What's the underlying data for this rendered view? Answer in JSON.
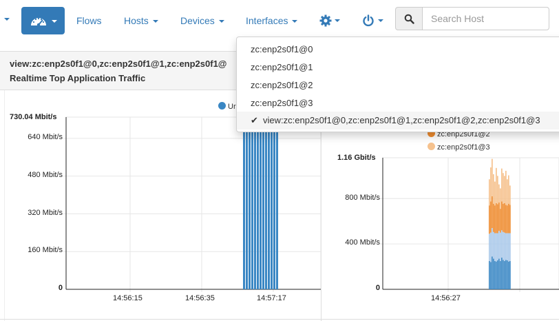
{
  "navbar": {
    "items": [
      {
        "label": "Flows",
        "has_caret": false
      },
      {
        "label": "Hosts",
        "has_caret": true
      },
      {
        "label": "Devices",
        "has_caret": true
      },
      {
        "label": "Interfaces",
        "has_caret": true
      }
    ],
    "dashboard_icon": "speedometer-icon",
    "settings_icon": "gear-icon",
    "power_icon": "power-icon",
    "search": {
      "placeholder": "Search Host",
      "value": "",
      "icon": "search-icon"
    },
    "accent_color": "#337ab7"
  },
  "panel": {
    "title": "view:zc:enp2s0f1@0,zc:enp2s0f1@1,zc:enp2s0f1@",
    "subtitle": "Realtime Top Application Traffic"
  },
  "interfaces_menu": {
    "items": [
      {
        "label": "zc:enp2s0f1@0",
        "selected": false
      },
      {
        "label": "zc:enp2s0f1@1",
        "selected": false
      },
      {
        "label": "zc:enp2s0f1@2",
        "selected": false
      },
      {
        "label": "zc:enp2s0f1@3",
        "selected": false
      },
      {
        "label": "view:zc:enp2s0f1@0,zc:enp2s0f1@1,zc:enp2s0f1@2,zc:enp2s0f1@3",
        "selected": true
      }
    ],
    "check_icon": "✔"
  },
  "chart_data": [
    {
      "type": "bar",
      "title": "Realtime Top Application Traffic",
      "ymax_label": "730.04 Mbit/s",
      "y_ticks": [
        "640 Mbit/s",
        "480 Mbit/s",
        "320 Mbit/s",
        "160 Mbit/s",
        "0"
      ],
      "x_ticks": [
        "14:56:15",
        "14:56:35",
        "14:57:17"
      ],
      "legend": [
        "Ur"
      ],
      "ylim": [
        0,
        730.04
      ],
      "series": [
        {
          "name": "Ur",
          "color": "#3a87c4",
          "values": [
            730,
            730,
            730,
            730,
            730,
            730,
            730,
            730,
            730,
            730,
            730,
            730,
            730
          ]
        }
      ]
    },
    {
      "type": "bar",
      "ymax_label": "1.16 Gbit/s",
      "y_ticks": [
        "800 Mbit/s",
        "400 Mbit/s",
        "0"
      ],
      "x_ticks": [
        "14:56:27"
      ],
      "legend": [
        "zc:enp2s0f1@2",
        "zc:enp2s0f1@3"
      ],
      "ylim": [
        0,
        1160
      ],
      "series": [
        {
          "name": "zc:enp2s0f1@0",
          "color": "#3a87c4",
          "values": [
            250,
            240,
            290,
            270,
            250,
            245,
            255,
            270,
            250,
            280,
            260,
            250,
            260,
            255,
            245,
            250
          ]
        },
        {
          "name": "zc:enp2s0f1@1",
          "color": "#aac9ea",
          "values": [
            240,
            260,
            250,
            235,
            245,
            250,
            240,
            245,
            250,
            240,
            245,
            250,
            235,
            240,
            250,
            245
          ]
        },
        {
          "name": "zc:enp2s0f1@2",
          "color": "#ee8b2f",
          "values": [
            250,
            275,
            280,
            250,
            245,
            265,
            255,
            250,
            210,
            255,
            250,
            260,
            250,
            245,
            260,
            250
          ]
        },
        {
          "name": "zc:enp2s0f1@3",
          "color": "#f6c28e",
          "values": [
            230,
            300,
            330,
            260,
            210,
            310,
            250,
            160,
            180,
            290,
            270,
            240,
            300,
            230,
            250,
            170
          ]
        }
      ]
    }
  ]
}
